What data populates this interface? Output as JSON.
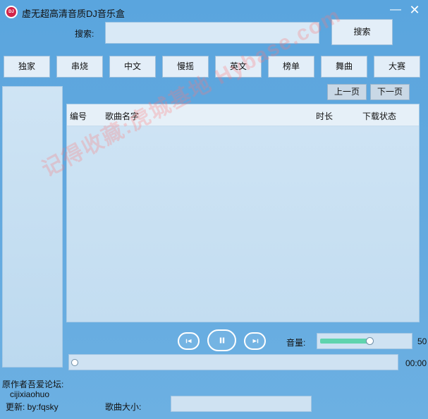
{
  "window": {
    "title": "虚无超高清音质DJ音乐盒",
    "logo_text": "DJ",
    "min_glyph": "—",
    "close_glyph": "✕"
  },
  "search": {
    "label": "搜索:",
    "value": "",
    "placeholder": "",
    "button_label": "搜索"
  },
  "categories": [
    "独家",
    "串烧",
    "中文",
    "慢摇",
    "英文",
    "榜单",
    "舞曲",
    "大赛"
  ],
  "paging": {
    "prev_label": "上一页",
    "next_label": "下一页"
  },
  "song_list": {
    "columns": [
      "编号",
      "歌曲名字",
      "时长",
      "下载状态"
    ],
    "rows": []
  },
  "watermark": {
    "text": "记得收藏:虎城基地  Hybase.com"
  },
  "player": {
    "volume_label": "音量:",
    "volume_value": "50",
    "volume_fraction": 0.5,
    "time": "00:00",
    "progress_fraction": 0.0
  },
  "footer": {
    "credit_line1": "原作者吾爱论坛:",
    "credit_line2": "cijixiaohuo",
    "credit_line3": "更新:  by:fqsky",
    "song_size_label": "歌曲大小:",
    "song_size_value": ""
  },
  "colors": {
    "background": "#63a9df",
    "volume_fill": "#5fd4ae",
    "logo": "#d2254a"
  },
  "icons": {
    "prev": "skip-previous-icon",
    "pause": "pause-icon",
    "next": "skip-next-icon"
  }
}
